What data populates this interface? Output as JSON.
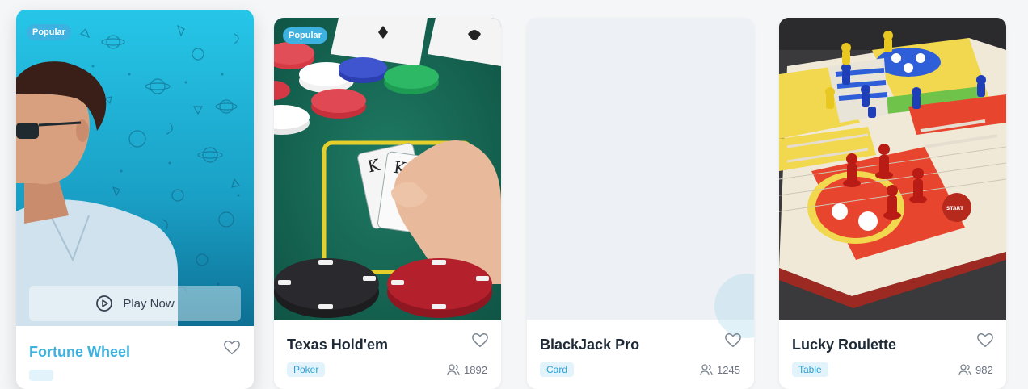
{
  "cards": [
    {
      "title": "Fortune Wheel",
      "badge": "Popular",
      "tag": "",
      "players": "",
      "play_label": "Play Now"
    },
    {
      "title": "Texas Hold'em",
      "badge": "Popular",
      "tag": "Poker",
      "players": "1892"
    },
    {
      "title": "BlackJack Pro",
      "badge": "",
      "tag": "Card",
      "players": "1245"
    },
    {
      "title": "Lucky Roulette",
      "badge": "",
      "tag": "Table",
      "players": "982"
    }
  ],
  "colors": {
    "accent": "#3db1df",
    "title_hover": "#3db1df"
  },
  "icons": [
    "heart-icon",
    "play-circle-icon",
    "users-icon"
  ]
}
